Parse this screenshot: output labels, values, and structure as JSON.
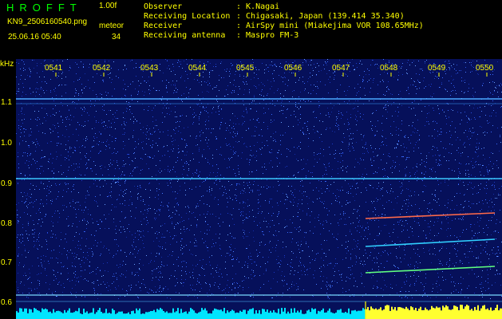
{
  "header": {
    "logo": "HROFFT",
    "version": "1.00f",
    "filename": "KN9_2506160540.png",
    "meteor_label": "meteor",
    "datetime": "25.06.16 05:40",
    "meteor_count": "34",
    "info": [
      {
        "key": "Observer",
        "value": ": K.Nagai"
      },
      {
        "key": "Receiving Location",
        "value": ": Chigasaki, Japan (139.414 35.340)"
      },
      {
        "key": "Receiver",
        "value": ": AirSpy mini (Miakejima VOR 108.65MHz)"
      },
      {
        "key": "Receiving antenna",
        "value": ": Maspro FM-3"
      }
    ]
  },
  "axis": {
    "unit": "kHz",
    "y_labels": [
      "1.1",
      "1.0",
      "0.9",
      "0.8",
      "0.7",
      "0.6"
    ],
    "time_ticks": [
      "0541",
      "0542",
      "0543",
      "0544",
      "0545",
      "0546",
      "0547",
      "0548",
      "0549",
      "0550"
    ]
  },
  "colors": {
    "background": "#000000",
    "label": "#ffff00",
    "logo": "#00ff00",
    "noise": "#0a1670",
    "bottom_bar": "#00e5ff"
  }
}
